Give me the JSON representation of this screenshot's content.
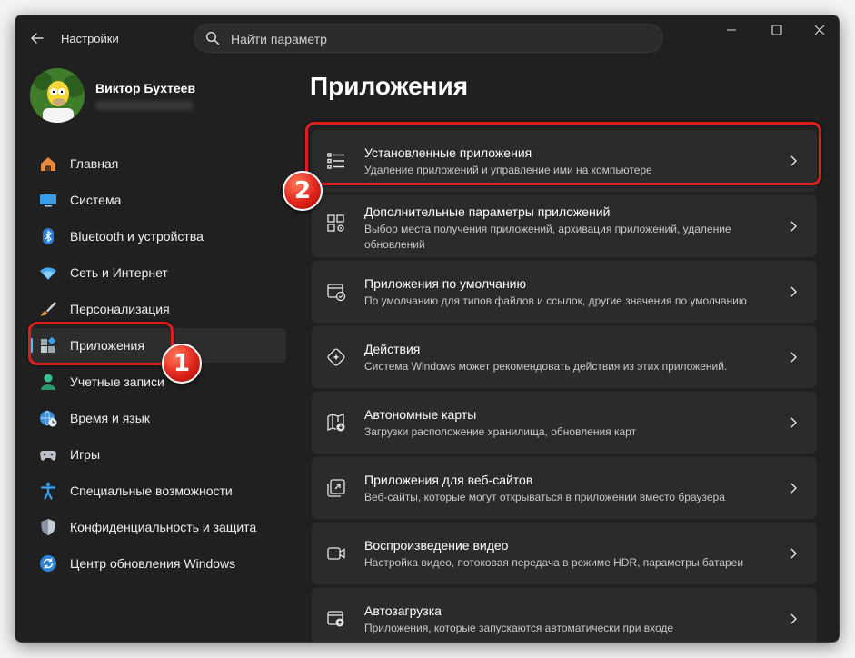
{
  "titlebar": {
    "app_title": "Настройки",
    "search_placeholder": "Найти параметр"
  },
  "profile": {
    "name": "Виктор Бухтеев"
  },
  "sidebar": {
    "items": [
      {
        "label": "Главная",
        "icon": "home-icon"
      },
      {
        "label": "Система",
        "icon": "system-icon"
      },
      {
        "label": "Bluetooth и устройства",
        "icon": "bluetooth-icon"
      },
      {
        "label": "Сеть и Интернет",
        "icon": "wifi-icon"
      },
      {
        "label": "Персонализация",
        "icon": "brush-icon"
      },
      {
        "label": "Приложения",
        "icon": "apps-icon",
        "active": true
      },
      {
        "label": "Учетные записи",
        "icon": "account-icon"
      },
      {
        "label": "Время и язык",
        "icon": "globe-clock-icon"
      },
      {
        "label": "Игры",
        "icon": "gamepad-icon"
      },
      {
        "label": "Специальные возможности",
        "icon": "accessibility-icon"
      },
      {
        "label": "Конфиденциальность и защита",
        "icon": "shield-icon"
      },
      {
        "label": "Центр обновления Windows",
        "icon": "update-icon"
      }
    ]
  },
  "main": {
    "title": "Приложения",
    "cards": [
      {
        "title": "Установленные приложения",
        "desc": "Удаление приложений и управление ими на компьютере",
        "icon": "list-icon"
      },
      {
        "title": "Дополнительные параметры приложений",
        "desc": "Выбор места получения приложений, архивация приложений, удаление обновлений",
        "icon": "apps-settings-icon"
      },
      {
        "title": "Приложения по умолчанию",
        "desc": "По умолчанию для типов файлов и ссылок, другие значения по умолчанию",
        "icon": "default-apps-icon"
      },
      {
        "title": "Действия",
        "desc": "Система Windows может рекомендовать действия из этих приложений.",
        "icon": "actions-icon"
      },
      {
        "title": "Автономные карты",
        "desc": "Загрузки расположение хранилища, обновления карт",
        "icon": "offline-map-icon"
      },
      {
        "title": "Приложения для веб-сайтов",
        "desc": "Веб-сайты, которые могут открываться в приложении вместо браузера",
        "icon": "web-apps-icon"
      },
      {
        "title": "Воспроизведение видео",
        "desc": "Настройка видео, потоковая передача в режиме HDR, параметры батареи",
        "icon": "video-icon"
      },
      {
        "title": "Автозагрузка",
        "desc": "Приложения, которые запускаются автоматически при входе",
        "icon": "startup-icon"
      }
    ]
  },
  "annotations": {
    "badge_1": "1",
    "badge_2": "2"
  },
  "colors": {
    "accent": "#4cc2ff",
    "highlight": "#e21d1d"
  }
}
